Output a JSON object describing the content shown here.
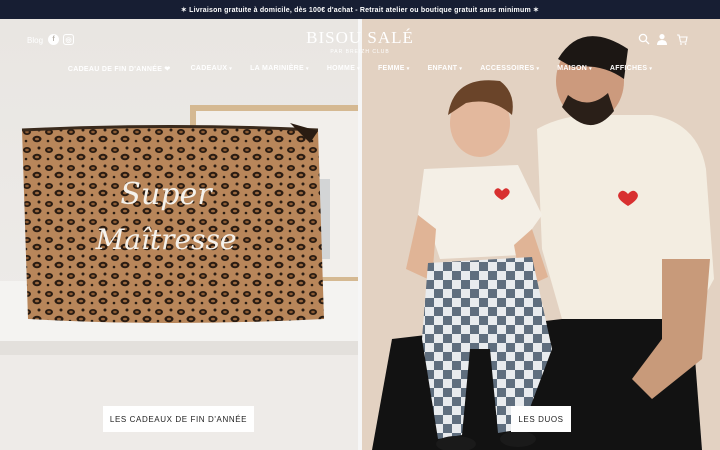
{
  "announcement": "✶ Livraison gratuite à domicile, dès 100€ d'achat - Retrait atelier ou boutique gratuit sans minimum ✶",
  "header": {
    "blog": "Blog",
    "logo": "BISOU SALÉ",
    "sublogo": "PAR BREIZH CLUB",
    "facebook_icon": "f",
    "instagram_icon": "◎"
  },
  "nav": [
    {
      "label": "CADEAU DE FIN D'ANNÉE ❤",
      "chevron": ""
    },
    {
      "label": "CADEAUX",
      "chevron": "▾"
    },
    {
      "label": "LA MARINIÈRE",
      "chevron": "▾"
    },
    {
      "label": "HOMME",
      "chevron": "▾"
    },
    {
      "label": "FEMME",
      "chevron": "▾"
    },
    {
      "label": "ENFANT",
      "chevron": "▾"
    },
    {
      "label": "ACCESSOIRES",
      "chevron": "▾"
    },
    {
      "label": "MAISON",
      "chevron": "▾"
    },
    {
      "label": "AFFICHES",
      "chevron": "▾"
    }
  ],
  "hero": {
    "left_cta": "LES CADEAUX DE FIN D'ANNÉE",
    "right_cta": "LES DUOS",
    "pouch_line1": "Super",
    "pouch_line2": "Maîtresse"
  }
}
